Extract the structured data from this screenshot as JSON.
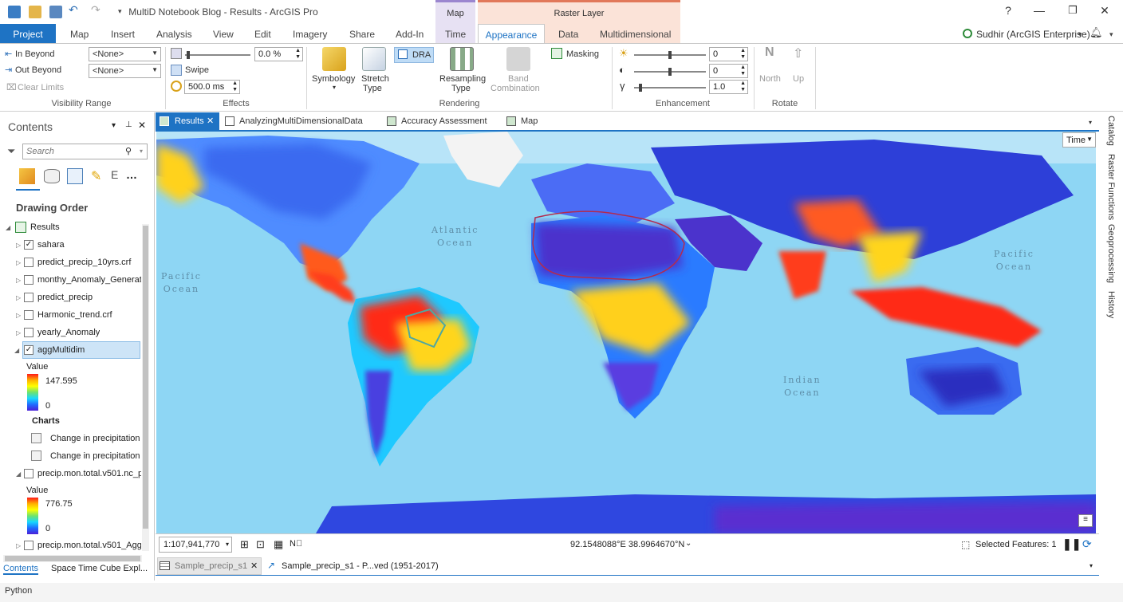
{
  "app": {
    "title": "MultiD Notebook Blog - Results - ArcGIS Pro",
    "help": "?"
  },
  "context_tabs": {
    "map": "Map",
    "raster_layer": "Raster Layer"
  },
  "ribbon_tabs": {
    "project": "Project",
    "items": [
      "Map",
      "Insert",
      "Analysis",
      "View",
      "Edit",
      "Imagery",
      "Share",
      "Add-In",
      "Time",
      "Appearance",
      "Data",
      "Multidimensional"
    ],
    "active": "Appearance"
  },
  "user": {
    "name": "Sudhir (ArcGIS Enterprise)"
  },
  "ribbon": {
    "visibility": {
      "in_beyond": "In Beyond",
      "out_beyond": "Out Beyond",
      "in_value": "<None>",
      "out_value": "<None>",
      "clear_limits": "Clear Limits",
      "group_label": "Visibility Range"
    },
    "effects": {
      "transparency_value": "0.0",
      "transparency_unit": "%",
      "swipe": "Swipe",
      "flicker_value": "500.0",
      "flicker_unit": "ms",
      "group_label": "Effects"
    },
    "rendering": {
      "symbology": "Symbology",
      "stretch_type_1": "Stretch",
      "stretch_type_2": "Type",
      "dra": "DRA",
      "resampling_1": "Resampling",
      "resampling_2": "Type",
      "band_1": "Band",
      "band_2": "Combination",
      "masking": "Masking",
      "group_label": "Rendering"
    },
    "enhancement": {
      "brightness": "0",
      "contrast": "0",
      "gamma": "1.0",
      "group_label": "Enhancement"
    },
    "rotate": {
      "north": "North",
      "up": "Up",
      "group_label": "Rotate"
    }
  },
  "contents": {
    "title": "Contents",
    "search_placeholder": "Search",
    "drawing_order": "Drawing Order",
    "map_name": "Results",
    "layers": [
      {
        "name": "sahara",
        "checked": true
      },
      {
        "name": "predict_precip_10yrs.crf",
        "checked": false
      },
      {
        "name": "monthy_Anomaly_Generate",
        "checked": false
      },
      {
        "name": "predict_precip",
        "checked": false
      },
      {
        "name": "Harmonic_trend.crf",
        "checked": false
      },
      {
        "name": "yearly_Anomaly",
        "checked": false
      },
      {
        "name": "aggMultidim",
        "checked": true
      }
    ],
    "legend1": {
      "title": "Value",
      "max": "147.595",
      "min": "0"
    },
    "charts_title": "Charts",
    "charts": [
      "Change in precipitation",
      "Change in  precipitation"
    ],
    "layer_precip_nc": "precip.mon.total.v501.nc_p",
    "legend2": {
      "title": "Value",
      "max": "776.75",
      "min": "0"
    },
    "layer_precip_agg": "precip.mon.total.v501_Agg"
  },
  "doc_tabs": [
    {
      "label": "Results",
      "active": true
    },
    {
      "label": "AnalyzingMultiDimensionalData",
      "active": false
    },
    {
      "label": "Accuracy Assessment",
      "active": false
    },
    {
      "label": "Map",
      "active": false
    }
  ],
  "map": {
    "time_button": "Time",
    "oceans": {
      "atlantic": "Atlantic\nOcean",
      "pacific_west": "Pacific\nOcean",
      "pacific_east": "Pacific\nOcean",
      "indian": "Indian\nOcean"
    }
  },
  "status": {
    "scale": "1:107,941,770",
    "coords": "92.1548088°E 38.9964670°N",
    "selected": "Selected Features: 1"
  },
  "right_panels": [
    "Catalog",
    "Raster Functions",
    "Geoprocessing",
    "History"
  ],
  "bottom_tabs": {
    "contents": "Contents",
    "stc": "Space Time Cube Expl...",
    "table": "Sample_precip_s1",
    "chart": "Sample_precip_s1 - P...ved (1951-2017)"
  },
  "python": "Python",
  "colors": {
    "accent": "#1e73c4",
    "context_map": "#c7b6e6",
    "context_raster": "#f2b9a1"
  }
}
